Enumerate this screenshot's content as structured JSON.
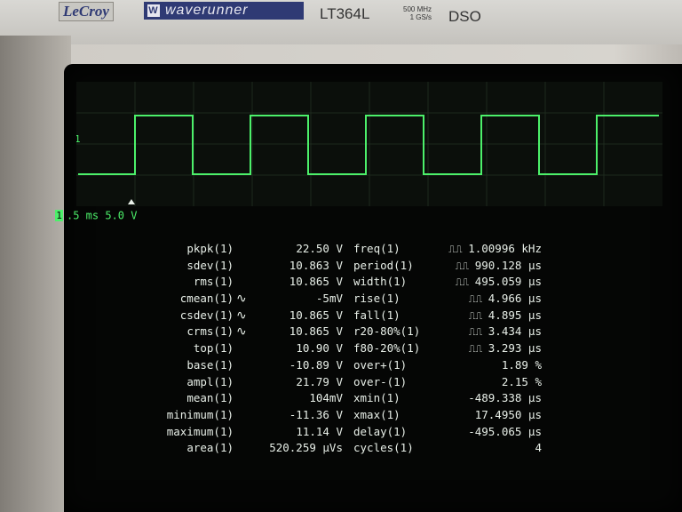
{
  "instrument": {
    "brand": "LeCroy",
    "series": "waverunner",
    "model": "LT364L",
    "spec_line1": "500 MHz",
    "spec_line2": "1 GS/s",
    "type": "DSO"
  },
  "trace": {
    "channel": "1",
    "status": ".5 ms 5.0 V",
    "trace_color": "#4cf06a",
    "cycles_shown": 4
  },
  "colors": {
    "screen": "#050605",
    "text": "#e8efe8",
    "trace": "#4cf06a"
  },
  "measurements_left": [
    {
      "name": "pkpk(1)",
      "mark": "",
      "value": "22.50 V"
    },
    {
      "name": "sdev(1)",
      "mark": "",
      "value": "10.863 V"
    },
    {
      "name": "rms(1)",
      "mark": "",
      "value": "10.865 V"
    },
    {
      "name": "cmean(1)",
      "mark": "~",
      "value": "-5mV"
    },
    {
      "name": "csdev(1)",
      "mark": "~",
      "value": "10.865 V"
    },
    {
      "name": "crms(1)",
      "mark": "~",
      "value": "10.865 V"
    },
    {
      "name": "top(1)",
      "mark": "",
      "value": "10.90 V"
    },
    {
      "name": "base(1)",
      "mark": "",
      "value": "-10.89 V"
    },
    {
      "name": "ampl(1)",
      "mark": "",
      "value": "21.79 V"
    },
    {
      "name": "mean(1)",
      "mark": "",
      "value": "104mV"
    },
    {
      "name": "minimum(1)",
      "mark": "",
      "value": "-11.36 V"
    },
    {
      "name": "maximum(1)",
      "mark": "",
      "value": "11.14 V"
    },
    {
      "name": "area(1)",
      "mark": "",
      "value": "520.259 µVs"
    }
  ],
  "measurements_right": [
    {
      "name": "freq(1)",
      "value": "1.00996 kHz"
    },
    {
      "name": "period(1)",
      "value": "990.128 µs"
    },
    {
      "name": "width(1)",
      "value": "495.059 µs"
    },
    {
      "name": "rise(1)",
      "value": "4.966 µs"
    },
    {
      "name": "fall(1)",
      "value": "4.895 µs"
    },
    {
      "name": "r20-80%(1)",
      "value": "3.434 µs"
    },
    {
      "name": "f80-20%(1)",
      "value": "3.293 µs"
    },
    {
      "name": "over+(1)",
      "value": "1.89 %"
    },
    {
      "name": "over-(1)",
      "value": "2.15 %"
    },
    {
      "name": "xmin(1)",
      "value": "-489.338 µs"
    },
    {
      "name": "xmax(1)",
      "value": "17.4950 µs"
    },
    {
      "name": "delay(1)",
      "value": "-495.065 µs"
    },
    {
      "name": "cycles(1)",
      "value": "4"
    }
  ],
  "waveform": {
    "high_level": 1,
    "low_level": 0,
    "duty_cycle": 0.5,
    "cycles": 4.5
  }
}
